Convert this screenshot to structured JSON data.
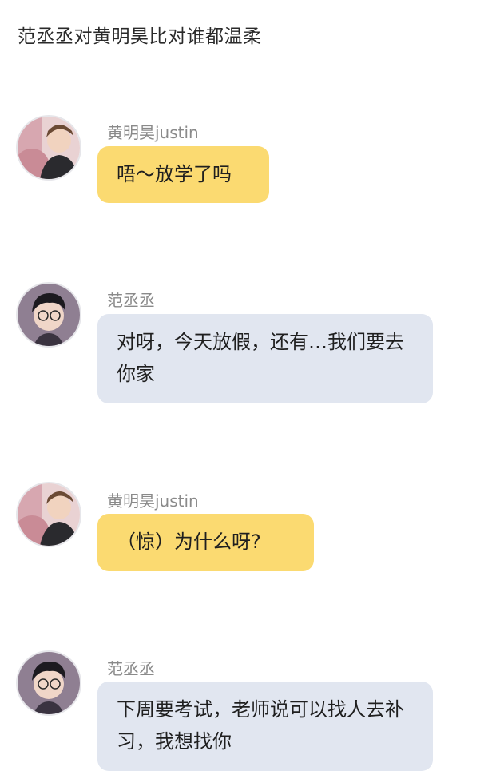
{
  "page": {
    "title": "范丞丞对黄明昊比对谁都温柔"
  },
  "messages": [
    {
      "sender": "黄明昊justin",
      "text": "唔～放学了吗",
      "bubble_color": "#fbda71",
      "avatar": "huang-minghao-avatar"
    },
    {
      "sender": "范丞丞",
      "text": "对呀，今天放假，还有…我们要去你家",
      "bubble_color": "#e1e6f0",
      "avatar": "fan-chengcheng-avatar"
    },
    {
      "sender": "黄明昊justin",
      "text": "（惊）为什么呀?",
      "bubble_color": "#fbda71",
      "avatar": "huang-minghao-avatar"
    },
    {
      "sender": "范丞丞",
      "text": "下周要考试，老师说可以找人去补习，我想找你",
      "bubble_color": "#e1e6f0",
      "avatar": "fan-chengcheng-avatar"
    }
  ]
}
